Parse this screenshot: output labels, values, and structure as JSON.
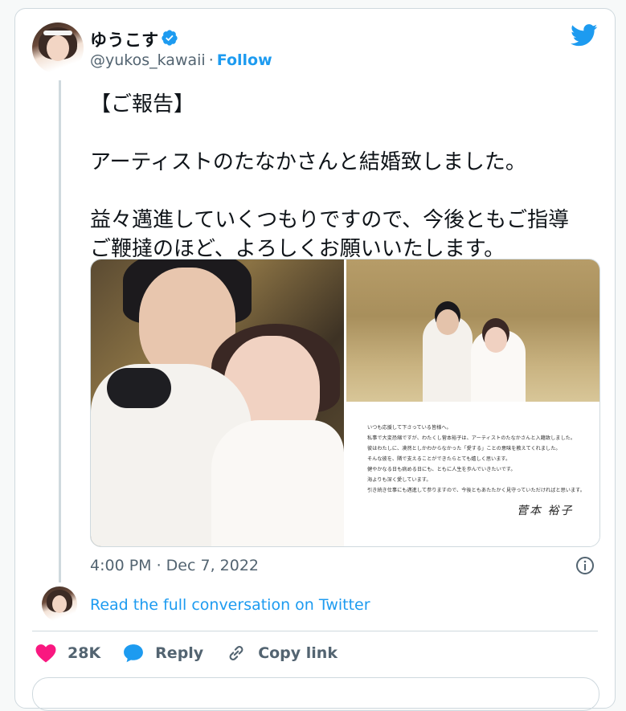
{
  "author": {
    "display_name": "ゆうこす",
    "handle": "@yukos_kawaii",
    "separator": "·",
    "follow_label": "Follow",
    "verified": true
  },
  "tweet": {
    "text": "【ご報告】\n\nアーティストのたなかさんと結婚致しました。\n\n益々邁進していくつもりですので、今後ともご指導\nご鞭撻のほど、よろしくお願いいたします。",
    "timestamp": "4:00 PM · Dec 7, 2022"
  },
  "letter": {
    "lines": [
      "いつも応援して下さっている皆様へ。",
      "私事で大変恐縮ですが、わたくし菅本裕子は、アーティストのたなかさんと入籍致しました。",
      "彼はわたしに、漠然としかわからなかった「愛する」ことの意味を教えてくれました。",
      "そんな彼を、隣で支えることができたらとても嬉しく思います。",
      "健やかなる日も病める日にも、ともに人生を歩んでいきたいです。",
      "海よりも深く愛しています。",
      "引き続き仕事にも邁進して参りますので、今後ともあたたかく見守っていただければと思います。"
    ],
    "signature": "菅本 裕子"
  },
  "conversation": {
    "link_label": "Read the full conversation on Twitter"
  },
  "actions": {
    "likes": "28K",
    "reply_label": "Reply",
    "copy_link_label": "Copy link"
  },
  "colors": {
    "accent": "#1d9bf0",
    "like": "#f91880",
    "text": "#0f1419",
    "muted": "#536471",
    "border": "#cfd9de"
  },
  "icons": [
    "verified-badge-icon",
    "twitter-bird-icon",
    "info-icon",
    "heart-icon",
    "reply-bubble-icon",
    "link-icon"
  ]
}
